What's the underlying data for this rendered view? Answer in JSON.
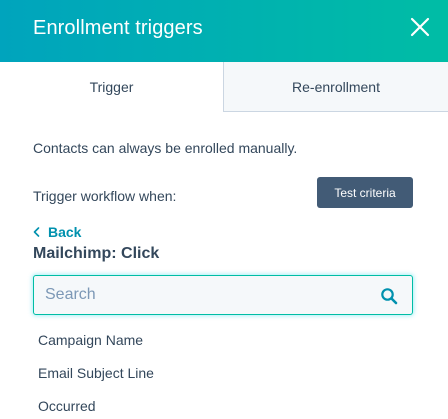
{
  "header": {
    "title": "Enrollment triggers"
  },
  "tabs": [
    {
      "label": "Trigger"
    },
    {
      "label": "Re-enrollment"
    }
  ],
  "info_text": "Contacts can always be enrolled manually.",
  "trigger_label": "Trigger workflow when:",
  "test_button": "Test criteria",
  "back_label": "Back",
  "section_title": "Mailchimp: Click",
  "search": {
    "placeholder": "Search",
    "value": ""
  },
  "properties": [
    {
      "label": "Campaign Name"
    },
    {
      "label": "Email Subject Line"
    },
    {
      "label": "Occurred"
    }
  ],
  "colors": {
    "header_gradient_start": "#00a4bd",
    "header_gradient_end": "#00bda5",
    "link": "#0091ae",
    "button": "#425b76",
    "text": "#33475b"
  }
}
